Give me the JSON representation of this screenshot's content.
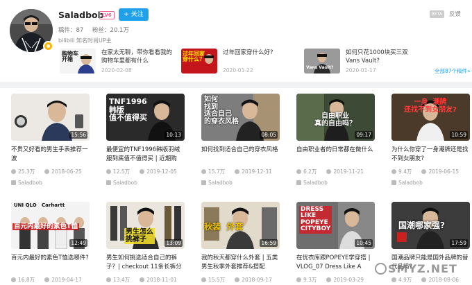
{
  "profile": {
    "name": "Saladbob",
    "level": "LV6",
    "follow_label": "+ 关注",
    "stats": {
      "videos": "稿件：87",
      "fans": "粉丝：20.1万"
    },
    "bio": "bilibili 知名时尚UP主",
    "beta": "BETA",
    "feedback": "反馈"
  },
  "featured": [
    {
      "title": "在家太无聊，带你看看我的购物车里都有什么",
      "date": "2020-02-08",
      "caption": "购物车\n开箱"
    },
    {
      "title": "过年回家穿什么好?",
      "date": "2020-01-22",
      "caption": "过年回家\n穿什么？"
    },
    {
      "title": "如何只花1000块买三双Vans Vault?",
      "date": "2020-01-17",
      "caption": "Vans Vault?"
    }
  ],
  "all_videos_link": "全部87个稿件»",
  "videos": [
    {
      "duration": "15:56",
      "title": "不贵又好看的男生手表推荐一波",
      "views": "25.3万",
      "date": "2018-06-25",
      "uploader": "Saladbob",
      "caption": "",
      "icon": "watch-thumbnail-icon"
    },
    {
      "duration": "10:13",
      "title": "最便宜的TNF1996韩版羽绒服到底值不值得买 | 近期购",
      "views": "12.5万",
      "date": "2019-12-05",
      "uploader": "Saladbob",
      "caption": "TNF1996\n韩版\n值不值得买",
      "icon": ""
    },
    {
      "duration": "08:05",
      "title": "如何找到适合自己的穿衣风格",
      "views": "15.7万",
      "date": "2019-12-31",
      "uploader": "Saladbob",
      "caption": "如何\n找到\n适合自己\n的穿衣风格",
      "icon": ""
    },
    {
      "duration": "09:17",
      "title": "自由职业者的日常都在做什么",
      "views": "6.2万",
      "date": "2019-11-21",
      "uploader": "Saladbob",
      "caption": "自由职业\n真的自由吗？",
      "icon": ""
    },
    {
      "duration": "10:59",
      "title": "为什么你穿了一身潮牌还是找不到女朋友?",
      "views": "9.4万",
      "date": "2019-06-15",
      "uploader": "Saladbob",
      "caption": "一身  潮牌\n还找不到女朋友?",
      "icon": ""
    },
    {
      "duration": "12:49",
      "title": "百元内最好的素色T恤选哪件?",
      "views": "16.8万",
      "date": "2019-04-17",
      "uploader": "",
      "caption": "百元内最好的素色T恤",
      "icon": "",
      "brands": "UNI QLO   Carhartt"
    },
    {
      "duration": "13:09",
      "title": "男生如何挑选适合自己的裤子？| checkout 11条长裤分",
      "views": "13.4万",
      "date": "2018-11-01",
      "uploader": "",
      "caption": "男生怎么\n挑裤子",
      "icon": ""
    },
    {
      "duration": "16:59",
      "title": "我的秋天都穿什么外套 | 五类男生秋季外套推荐&搭配",
      "views": "15.5万",
      "date": "2018-09-17",
      "uploader": "",
      "caption": "秋装  外套",
      "icon": ""
    },
    {
      "duration": "10:45",
      "title": "在优衣库跟POPEYE学穿搭 | VLOG_07 Dress Like A",
      "views": "9.3万",
      "date": "2019-03-29",
      "uploader": "",
      "caption": "DRESS\nLIKE\nPOPEYE\nCITYBOY",
      "icon": ""
    },
    {
      "duration": "17:59",
      "title": "国潮品牌只能是国外品牌的替代品吗？",
      "views": "4.9万",
      "date": "2018-08-06",
      "uploader": "",
      "caption": "国潮哪家强?",
      "icon": ""
    }
  ],
  "watermark": "SMYZ.NET"
}
